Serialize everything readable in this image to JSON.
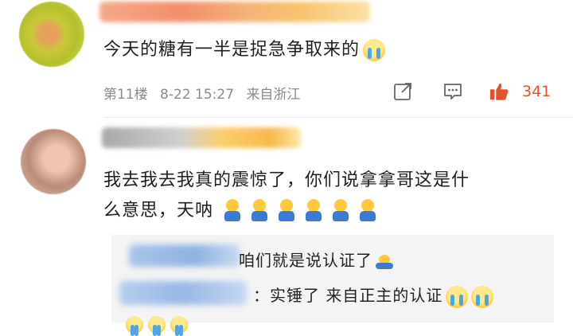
{
  "comments": [
    {
      "text": "今天的糖有一半是捉急争取来的",
      "emoji": "cry-emoji",
      "meta": {
        "floor": "第11楼",
        "time": "8-22 15:27",
        "location": "来自浙江"
      },
      "like_count": "341"
    },
    {
      "line1": "我去我去我真的震惊了，你们说拿拿哥这是什",
      "line2": "么意思，天呐",
      "emoji": "sad-emoji",
      "emoji_count": 6
    }
  ],
  "replies": [
    {
      "text": "咱们就是说认证了",
      "emoji": "sad-emoji"
    },
    {
      "text": "：实锤了 来自正主的认证",
      "emoji": "cry-emoji"
    }
  ],
  "icons": {
    "share": "share-icon",
    "comment": "comment-icon",
    "like": "thumbs-up-icon"
  },
  "colors": {
    "like": "#e8502b",
    "meta": "#8a8a8a"
  }
}
